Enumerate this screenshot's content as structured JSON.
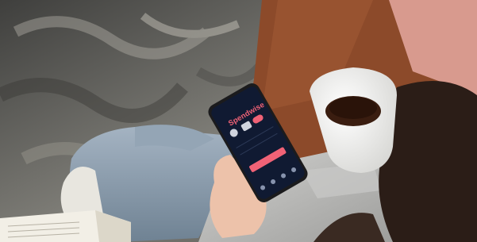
{
  "scene": {
    "app": {
      "name": "Spendwise"
    },
    "colors": {
      "phone_screen": "#101a32",
      "brand_pink": "#f06276",
      "sofa_brown": "#8c4a2a",
      "coffee": "#3a1d10",
      "mug": "#f2f2ef",
      "sweater": "#b9b9b7",
      "jeans": "#8a9bab"
    },
    "icons": [
      "bell-icon",
      "gear-icon",
      "toggle-icon",
      "home-icon",
      "chart-icon",
      "card-icon",
      "profile-icon"
    ]
  }
}
